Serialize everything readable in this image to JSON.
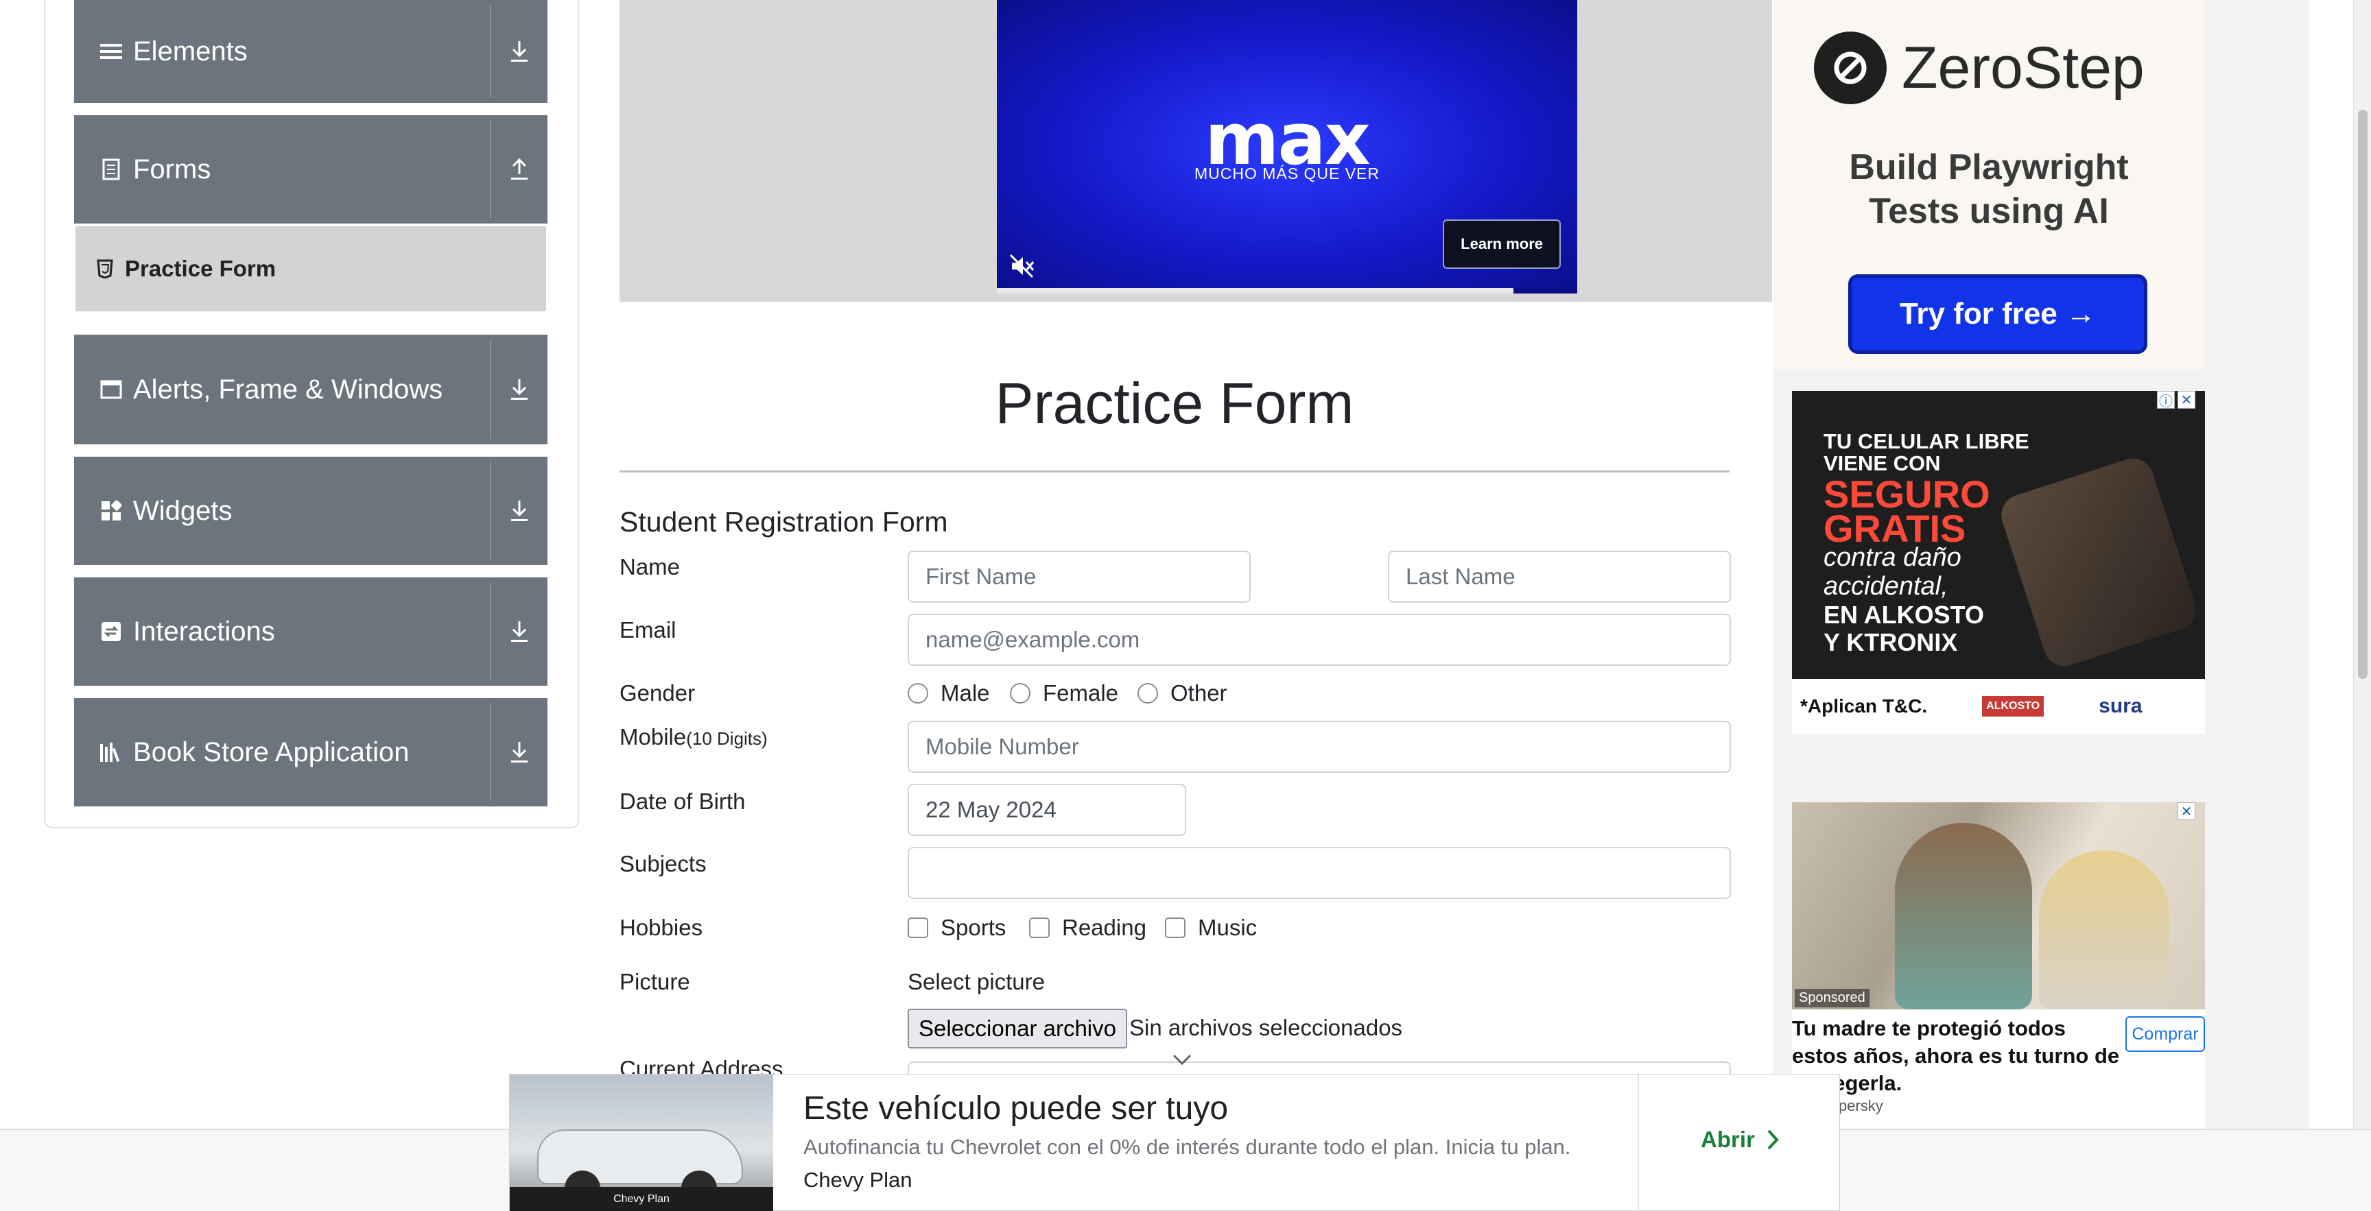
{
  "sidebar": {
    "groups": [
      {
        "title": "Elements",
        "icon": "hamburger-icon",
        "arrow": "download-arrow-icon"
      },
      {
        "title": "Forms",
        "icon": "document-icon",
        "arrow": "upload-arrow-icon"
      },
      {
        "title": "Alerts, Frame & Windows",
        "icon": "window-icon",
        "arrow": "download-arrow-icon"
      },
      {
        "title": "Widgets",
        "icon": "widgets-icon",
        "arrow": "download-arrow-icon"
      },
      {
        "title": "Interactions",
        "icon": "interactions-icon",
        "arrow": "download-arrow-icon"
      },
      {
        "title": "Book Store Application",
        "icon": "library-icon",
        "arrow": "download-arrow-icon"
      }
    ],
    "active_item": {
      "label": "Practice Form",
      "icon": "html5-icon"
    }
  },
  "video_ad": {
    "logo": "max",
    "tagline": "MUCHO MÁS QUE VER",
    "cta": "Learn more",
    "progress": 0.89
  },
  "page": {
    "title": "Practice Form",
    "form_heading": "Student Registration Form"
  },
  "form": {
    "name_label": "Name",
    "first_name_placeholder": "First Name",
    "last_name_placeholder": "Last Name",
    "email_label": "Email",
    "email_placeholder": "name@example.com",
    "gender_label": "Gender",
    "gender_options": [
      "Male",
      "Female",
      "Other"
    ],
    "mobile_label": "Mobile",
    "mobile_hint": "(10 Digits)",
    "mobile_placeholder": "Mobile Number",
    "dob_label": "Date of Birth",
    "dob_value": "22 May 2024",
    "subjects_label": "Subjects",
    "hobbies_label": "Hobbies",
    "hobby_options": [
      "Sports",
      "Reading",
      "Music"
    ],
    "picture_label": "Picture",
    "picture_prompt": "Select picture",
    "file_button": "Seleccionar archivo",
    "file_status": "Sin archivos seleccionados",
    "partial_label": "Current Address"
  },
  "right_ads": {
    "zerostep": {
      "brand": "ZeroStep",
      "line1": "Build Playwright",
      "line2": "Tests using AI",
      "cta": "Try for free →"
    },
    "celular": {
      "l1": "TU CELULAR LIBRE",
      "l2": "VIENE CON",
      "l3": "SEGURO",
      "l4": "GRATIS",
      "l5": "contra daño",
      "l6": "accidental,",
      "l7": "EN ALKOSTO",
      "l8": "Y KTRONIX",
      "footer": "*Aplican T&C.",
      "badge1": "ALKOSTO",
      "badge2": "sura"
    },
    "kaspersky": {
      "sponsored": "Sponsored",
      "headline": "Tu madre te protegió todos estos años, ahora es tu turno de protegerla.",
      "cta": "Comprar",
      "brand": "Kaspersky"
    }
  },
  "bottom_ad": {
    "headline": "Este vehículo puede ser tuyo",
    "description": "Autofinancia tu Chevrolet con el 0% de interés durante todo el plan. Inicia tu plan.",
    "advertiser": "Chevy Plan",
    "cta": "Abrir",
    "car_strip": "Chevy Plan"
  }
}
